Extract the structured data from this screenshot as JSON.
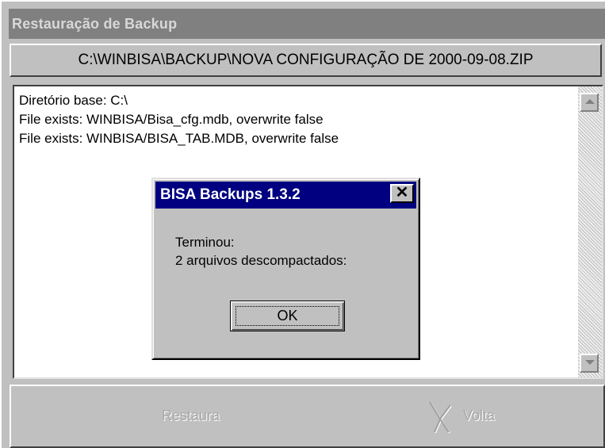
{
  "window": {
    "title": "Restauração de Backup",
    "path": "C:\\WINBISA\\BACKUP\\NOVA CONFIGURAÇÃO DE 2000-09-08.ZIP"
  },
  "log": {
    "lines": [
      "Diretório base: C:\\",
      "File exists: WINBISA/Bisa_cfg.mdb, overwrite false",
      "File exists: WINBISA/BISA_TAB.MDB, overwrite false"
    ]
  },
  "dialog": {
    "title": "BISA Backups 1.3.2",
    "close_label": "✕",
    "message_line1": "Terminou:",
    "message_line2": "2 arquivos descompactados:",
    "ok_label": "OK"
  },
  "buttons": {
    "restaura_label": "Restaura",
    "volta_label": "Volta",
    "volta_icon": "cut-scissors-icon"
  },
  "colors": {
    "face": "#c0c0c0",
    "dialog_title": "#000080",
    "window_title": "#808080",
    "disabled_text": "#a8a8a8"
  }
}
